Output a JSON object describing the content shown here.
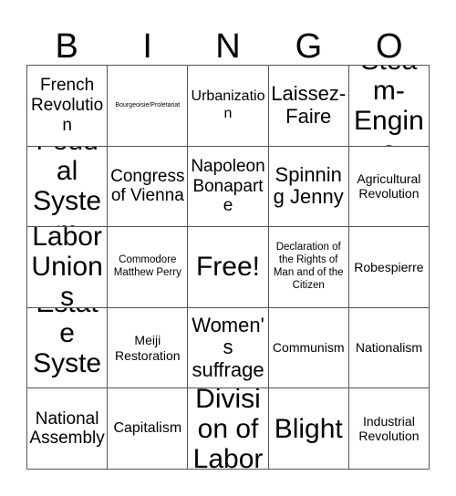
{
  "card": {
    "header_letters": [
      "B",
      "I",
      "N",
      "G",
      "O"
    ],
    "free_space_label": "Free!",
    "rows": [
      [
        {
          "text": "French Revolution",
          "size": "fs-l"
        },
        {
          "text": "Bourgeoisie/Proletariat",
          "size": "fs-xxs"
        },
        {
          "text": "Urbanization",
          "size": "fs-m"
        },
        {
          "text": "Laissez-Faire",
          "size": "fs-xl"
        },
        {
          "text": "Steam-Engine",
          "size": "fs-xxl"
        }
      ],
      [
        {
          "text": "Feudal System",
          "size": "fs-xxl"
        },
        {
          "text": "Congress of Vienna",
          "size": "fs-l"
        },
        {
          "text": "Napoleon Bonaparte",
          "size": "fs-l"
        },
        {
          "text": "Spinning Jenny",
          "size": "fs-xl"
        },
        {
          "text": "Agricultural Revolution",
          "size": "fs-s"
        }
      ],
      [
        {
          "text": "Labor Unions",
          "size": "fs-xxl"
        },
        {
          "text": "Commodore Matthew Perry",
          "size": "fs-xs"
        },
        {
          "text": "Free!",
          "size": "fs-xxl"
        },
        {
          "text": "Declaration of the Rights of Man and of the Citizen",
          "size": "fs-xs"
        },
        {
          "text": "Robespierre",
          "size": "fs-s"
        }
      ],
      [
        {
          "text": "Estate System",
          "size": "fs-xxl"
        },
        {
          "text": "Meiji Restoration",
          "size": "fs-s"
        },
        {
          "text": "Women's suffrage",
          "size": "fs-xl"
        },
        {
          "text": "Communism",
          "size": "fs-s"
        },
        {
          "text": "Nationalism",
          "size": "fs-s"
        }
      ],
      [
        {
          "text": "National Assembly",
          "size": "fs-l"
        },
        {
          "text": "Capitalism",
          "size": "fs-m"
        },
        {
          "text": "Division of Labor",
          "size": "fs-xxl"
        },
        {
          "text": "Blight",
          "size": "fs-xxl"
        },
        {
          "text": "Industrial Revolution",
          "size": "fs-s"
        }
      ]
    ]
  },
  "colors": {
    "background": "#ffffff",
    "text": "#000000",
    "grid_line": "#555555"
  }
}
